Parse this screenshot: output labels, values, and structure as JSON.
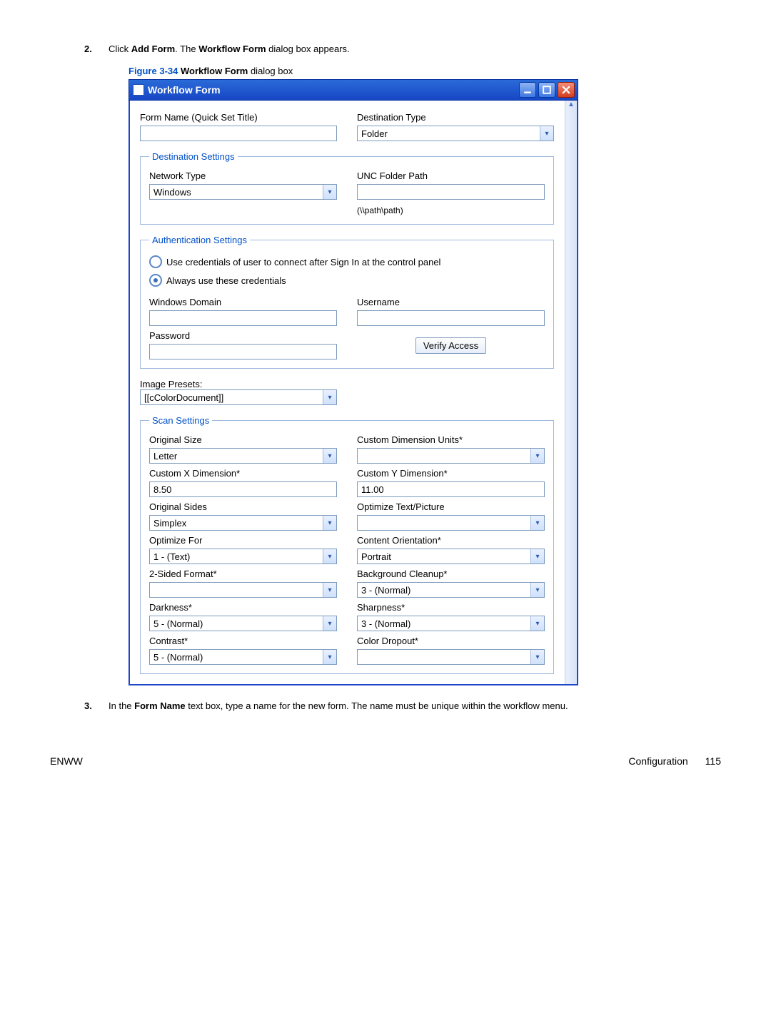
{
  "step2": {
    "num": "2.",
    "pre": "Click ",
    "b1": "Add Form",
    "mid": ". The ",
    "b2": "Workflow Form",
    "post": " dialog box appears."
  },
  "figcaption": {
    "label": "Figure 3-34  ",
    "bold": "Workflow Form",
    "rest": " dialog box"
  },
  "titlebar": {
    "title": "Workflow Form"
  },
  "form": {
    "formNameLabel": "Form Name (Quick Set Title)",
    "destTypeLabel": "Destination Type",
    "destTypeValue": "Folder"
  },
  "destSettings": {
    "legend": "Destination Settings",
    "networkTypeLabel": "Network Type",
    "networkTypeValue": "Windows",
    "uncLabel": "UNC Folder Path",
    "uncHint": "(\\\\path\\path)"
  },
  "authSettings": {
    "legend": "Authentication Settings",
    "radio1": "Use credentials of user to connect after Sign In at the control panel",
    "radio2": "Always use these credentials",
    "winDomainLabel": "Windows Domain",
    "usernameLabel": "Username",
    "passwordLabel": "Password",
    "verifyBtn": "Verify Access"
  },
  "presets": {
    "label": "Image Presets:",
    "value": "[[cColorDocument]]"
  },
  "scan": {
    "legend": "Scan Settings",
    "origSizeLabel": "Original Size",
    "origSizeValue": "Letter",
    "custUnitsLabel": "Custom Dimension Units*",
    "custUnitsValue": "",
    "custXLabel": "Custom X Dimension*",
    "custXValue": "8.50",
    "custYLabel": "Custom Y Dimension*",
    "custYValue": "11.00",
    "origSidesLabel": "Original Sides",
    "origSidesValue": "Simplex",
    "optTPLabel": "Optimize Text/Picture",
    "optTPValue": "",
    "optForLabel": "Optimize For",
    "optForValue": "1 - (Text)",
    "contentOrientLabel": "Content Orientation*",
    "contentOrientValue": "Portrait",
    "twoSidedLabel": "2-Sided Format*",
    "twoSidedValue": "",
    "bgCleanLabel": "Background Cleanup*",
    "bgCleanValue": "3 - (Normal)",
    "darknessLabel": "Darkness*",
    "darknessValue": "5 - (Normal)",
    "sharpLabel": "Sharpness*",
    "sharpValue": "3 - (Normal)",
    "contrastLabel": "Contrast*",
    "contrastValue": "5 - (Normal)",
    "dropoutLabel": "Color Dropout*",
    "dropoutValue": ""
  },
  "step3": {
    "num": "3.",
    "pre": "In the ",
    "b1": "Form Name",
    "post": " text box, type a name for the new form. The name must be unique within the workflow menu."
  },
  "footer": {
    "left": "ENWW",
    "section": "Configuration",
    "page": "115"
  }
}
